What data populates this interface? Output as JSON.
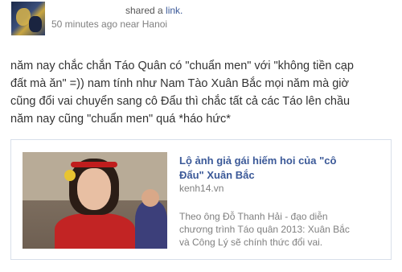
{
  "post": {
    "shared_prefix": "shared a",
    "shared_link": "link.",
    "time": "50 minutes ago near Hanoi",
    "text_lines": [
      "năm nay chắc chắn Táo Quân có \"chuẩn men\" với \"không tiền cạp",
      "đất mà ăn\" =)) nam tính như Nam Tào Xuân Bắc mọi năm mà giờ",
      "cũng đổi vai chuyển sang cô Đẩu thì chắc tất cả các Táo lên chầu",
      "năm nay cũng \"chuẩn men\" quá *háo hức*"
    ]
  },
  "attachment": {
    "title_lines": [
      "Lộ ảnh giả gái hiếm hoi của \"cô",
      "Đẩu\" Xuân Bắc"
    ],
    "domain": "kenh14.vn",
    "description_lines": [
      "Theo ông Đỗ Thanh Hải - đạo diễn",
      "chương trình Táo quân 2013: Xuân Bắc",
      "và Công Lý sẽ chính thức đổi vai."
    ]
  },
  "colors": {
    "link": "#3b5998",
    "meta": "#808080",
    "text": "#333333",
    "border": "#d8dfea"
  }
}
